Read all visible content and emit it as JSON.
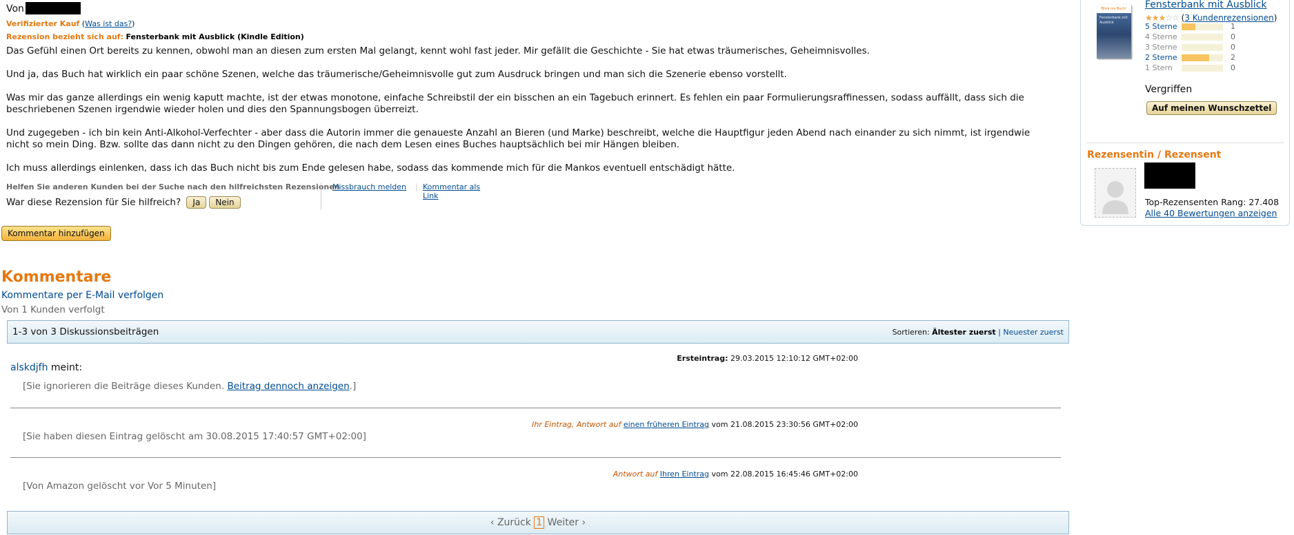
{
  "review": {
    "by_label": "Von",
    "verified_label": "Verifizierter Kauf",
    "verified_help_open": "(",
    "verified_help_link": "Was ist das?",
    "verified_help_close": ")",
    "relates_label": "Rezension bezieht sich auf:",
    "relates_title": "Fensterbank mit Ausblick (Kindle Edition)",
    "paragraphs": [
      "Das Gefühl einen Ort bereits zu kennen, obwohl man an diesen zum ersten Mal gelangt, kennt wohl fast jeder. Mir gefällt die Geschichte - Sie hat etwas träumerisches, Geheimnisvolles.",
      "Und ja, das Buch hat wirklich ein paar schöne Szenen, welche das träumerische/Geheimnisvolle gut zum Ausdruck bringen und man sich die Szenerie ebenso vorstellt.",
      "Was mir das ganze allerdings ein wenig kaputt machte, ist der etwas monotone, einfache Schreibstil der ein bisschen an ein Tagebuch erinnert. Es fehlen ein paar Formulierungsraffinessen, sodass auffällt, dass sich die beschriebenen Szenen irgendwie wieder holen und dies den Spannungsbogen überreizt.",
      "Und zugegeben - ich bin kein Anti-Alkohol-Verfechter - aber dass die Autorin immer die genaueste Anzahl an Bieren (und Marke) beschreibt, welche die Hauptfigur jeden Abend nach einander zu sich nimmt, ist irgendwie nicht so mein Ding. Bzw. sollte das dann nicht zu den Dingen gehören, die nach dem Lesen eines Buches hauptsächlich bei mir Hängen bleiben.",
      "Ich muss allerdings einlenken, dass ich das Buch nicht bis zum Ende gelesen habe, sodass das kommende mich für die Mankos eventuell entschädigt hätte."
    ],
    "helpful_hint": "Helfen Sie anderen Kunden bei der Suche nach den hilfreichsten Rezensionen",
    "helpful_question": "War diese Rezension für Sie hilfreich?",
    "yes_label": "Ja",
    "no_label": "Nein",
    "report_label": "Missbrauch melden",
    "link_sep": "|",
    "permalink_label": "Kommentar als Link",
    "add_comment_label": "Kommentar hinzufügen"
  },
  "comments": {
    "title": "Kommentare",
    "follow_email": "Kommentare per E-Mail verfolgen",
    "followers": "Von 1 Kunden verfolgt",
    "count": "1-3 von 3 Diskussionsbeiträgen",
    "sort_label": "Sortieren:",
    "sort_active": "Ältester zuerst",
    "sort_pipe": "|",
    "sort_other": "Neuester zuerst",
    "posts": [
      {
        "user": "alskdjfh",
        "says": " meint:",
        "meta_label": "Ersteintrag:",
        "meta_date": " 29.03.2015 12:10:12 GMT+02:00",
        "ignored_before": "[Sie ignorieren die Beiträge dieses Kunden. ",
        "ignored_link": "Beitrag dennoch anzeigen",
        "ignored_after": ".]"
      },
      {
        "meta_prefix": "Ihr Eintrag, Antwort auf ",
        "meta_link": "einen früheren Eintrag",
        "meta_date": " vom 21.08.2015 23:30:56 GMT+02:00",
        "body": "[Sie haben diesen Eintrag gelöscht am 30.08.2015 17:40:57 GMT+02:00]"
      },
      {
        "meta_prefix": "Antwort auf ",
        "meta_link": "Ihren Eintrag",
        "meta_date": " vom 22.08.2015 16:45:46 GMT+02:00",
        "body": "[Von Amazon gelöscht vor Vor 5 Minuten]"
      }
    ],
    "pager": {
      "prev": "‹ Zurück",
      "current": "1",
      "next": "Weiter ›"
    }
  },
  "sidebar": {
    "cover_top": "Blick ins Buch!",
    "cover_title": "Fensterbank mit Ausblick",
    "book_title": "Fensterbank mit Ausblick",
    "stars_filled": "★★★",
    "stars_empty": "☆☆",
    "review_count_open": " (",
    "review_count_link": "3 Kundenrezensionen",
    "review_count_close": ")",
    "rating_average": 3,
    "histogram": [
      {
        "label": "5 Sterne",
        "count": "1",
        "fraction": 0.33,
        "linked": true
      },
      {
        "label": "4 Sterne",
        "count": "0",
        "fraction": 0,
        "linked": false
      },
      {
        "label": "3 Sterne",
        "count": "0",
        "fraction": 0,
        "linked": false
      },
      {
        "label": "2 Sterne",
        "count": "2",
        "fraction": 0.67,
        "linked": true
      },
      {
        "label": "1 Stern",
        "count": "0",
        "fraction": 0,
        "linked": false
      }
    ],
    "availability": "Vergriffen",
    "wishlist_label": "Auf meinen Wunschzettel",
    "reviewer_heading": "Rezensentin / Rezensent",
    "rank": "Top-Rezensenten Rang: 27.408",
    "all_ratings": "Alle 40 Bewertungen anzeigen"
  },
  "colors": {
    "accent_orange": "#e47911",
    "link_blue": "#004b91",
    "bar_border": "#8fb6cf",
    "hist_fill": "#f7c45f"
  }
}
